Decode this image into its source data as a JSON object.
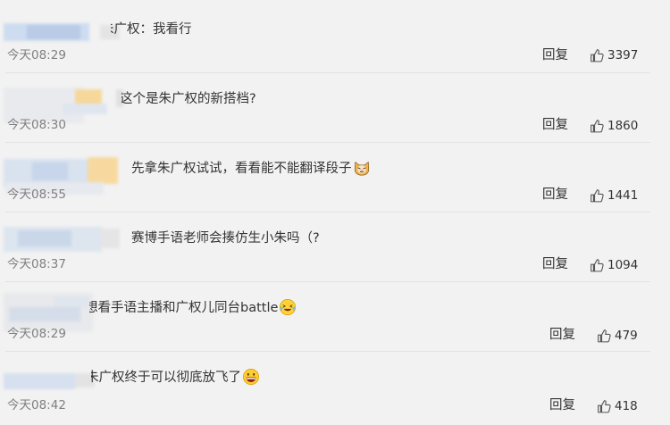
{
  "reply_label": "回复",
  "colors": {
    "background": "#f2f2f2",
    "divider": "#e2e2e2",
    "timestamp": "#808080",
    "text": "#333333"
  },
  "comments": [
    {
      "text": "朱广权：我看行",
      "time": "今天08:29",
      "likes": "3397"
    },
    {
      "text": "这个是朱广权的新搭档?",
      "time": "今天08:30",
      "likes": "1860"
    },
    {
      "text": "先拿朱广权试试，看看能不能翻译段子",
      "emoji": "cat-face-emoji",
      "time": "今天08:55",
      "likes": "1441"
    },
    {
      "text": "赛博手语老师会揍仿生小朱吗（?",
      "time": "今天08:37",
      "likes": "1094"
    },
    {
      "text": "想看手语主播和广权儿同台battle",
      "emoji": "laughing-tears-emoji",
      "time": "今天08:29",
      "likes": "479"
    },
    {
      "text": "朱广权终于可以彻底放飞了",
      "emoji": "grinning-emoji",
      "time": "今天08:42",
      "likes": "418"
    }
  ]
}
